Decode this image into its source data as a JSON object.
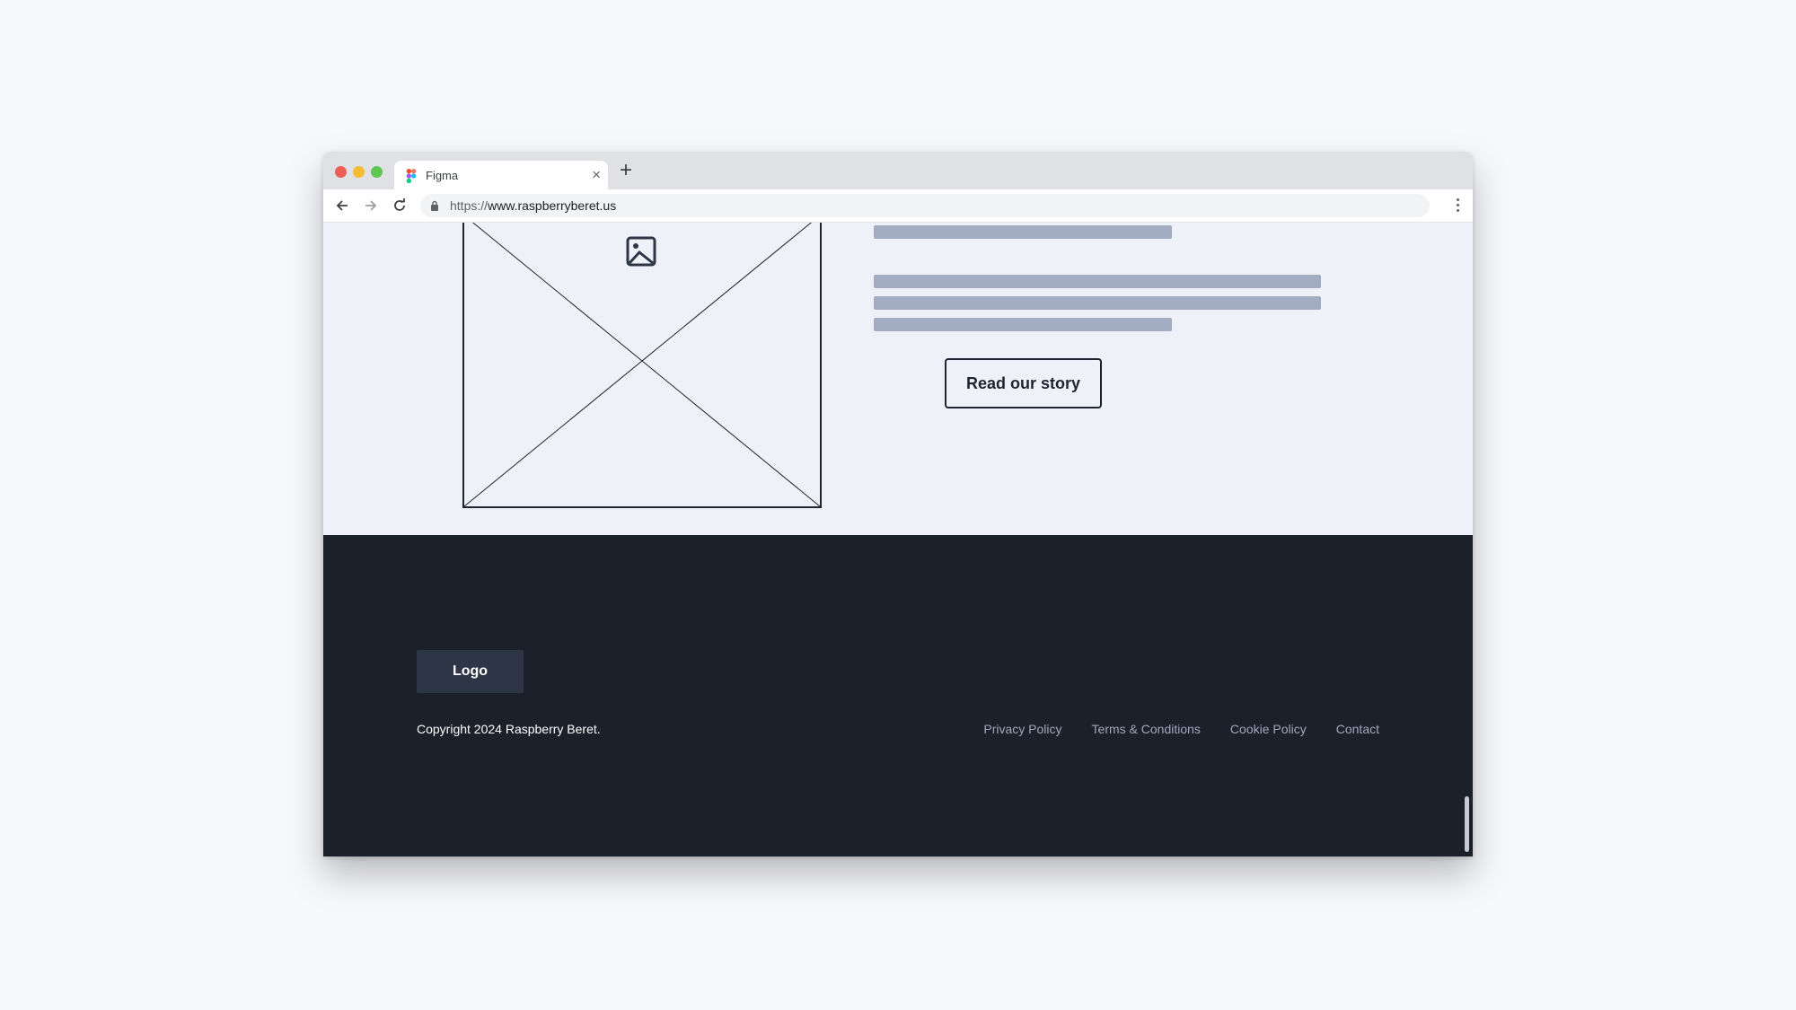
{
  "browser": {
    "tab": {
      "title": "Figma",
      "favicon": "figma-logo-icon",
      "close_icon": "close-icon"
    },
    "new_tab_icon": "plus-icon",
    "nav": {
      "back_icon": "arrow-left-icon",
      "forward_icon": "arrow-right-icon",
      "reload_icon": "reload-icon"
    },
    "address": {
      "scheme": "https://",
      "host": "www.raspberryberet.us",
      "lock_icon": "lock-icon"
    },
    "menu_icon": "kebab-menu-icon",
    "traffic_lights": {
      "close": "#ee5e56",
      "minimize": "#f6bd33",
      "maximize": "#5fc553"
    }
  },
  "content": {
    "image_placeholder_icon": "image-icon",
    "read_story_button": "Read our story"
  },
  "footer": {
    "logo": "Logo",
    "copyright": "Copyright 2024 Raspberry Beret.",
    "links": [
      "Privacy Policy",
      "Terms & Conditions",
      "Cookie Policy",
      "Contact"
    ]
  },
  "colors": {
    "page_bg": "#eef1f8",
    "footer_bg": "#1b202b",
    "skeleton": "#a2adc2",
    "ink": "#1f2430",
    "footer_link": "#a0a8ba"
  }
}
